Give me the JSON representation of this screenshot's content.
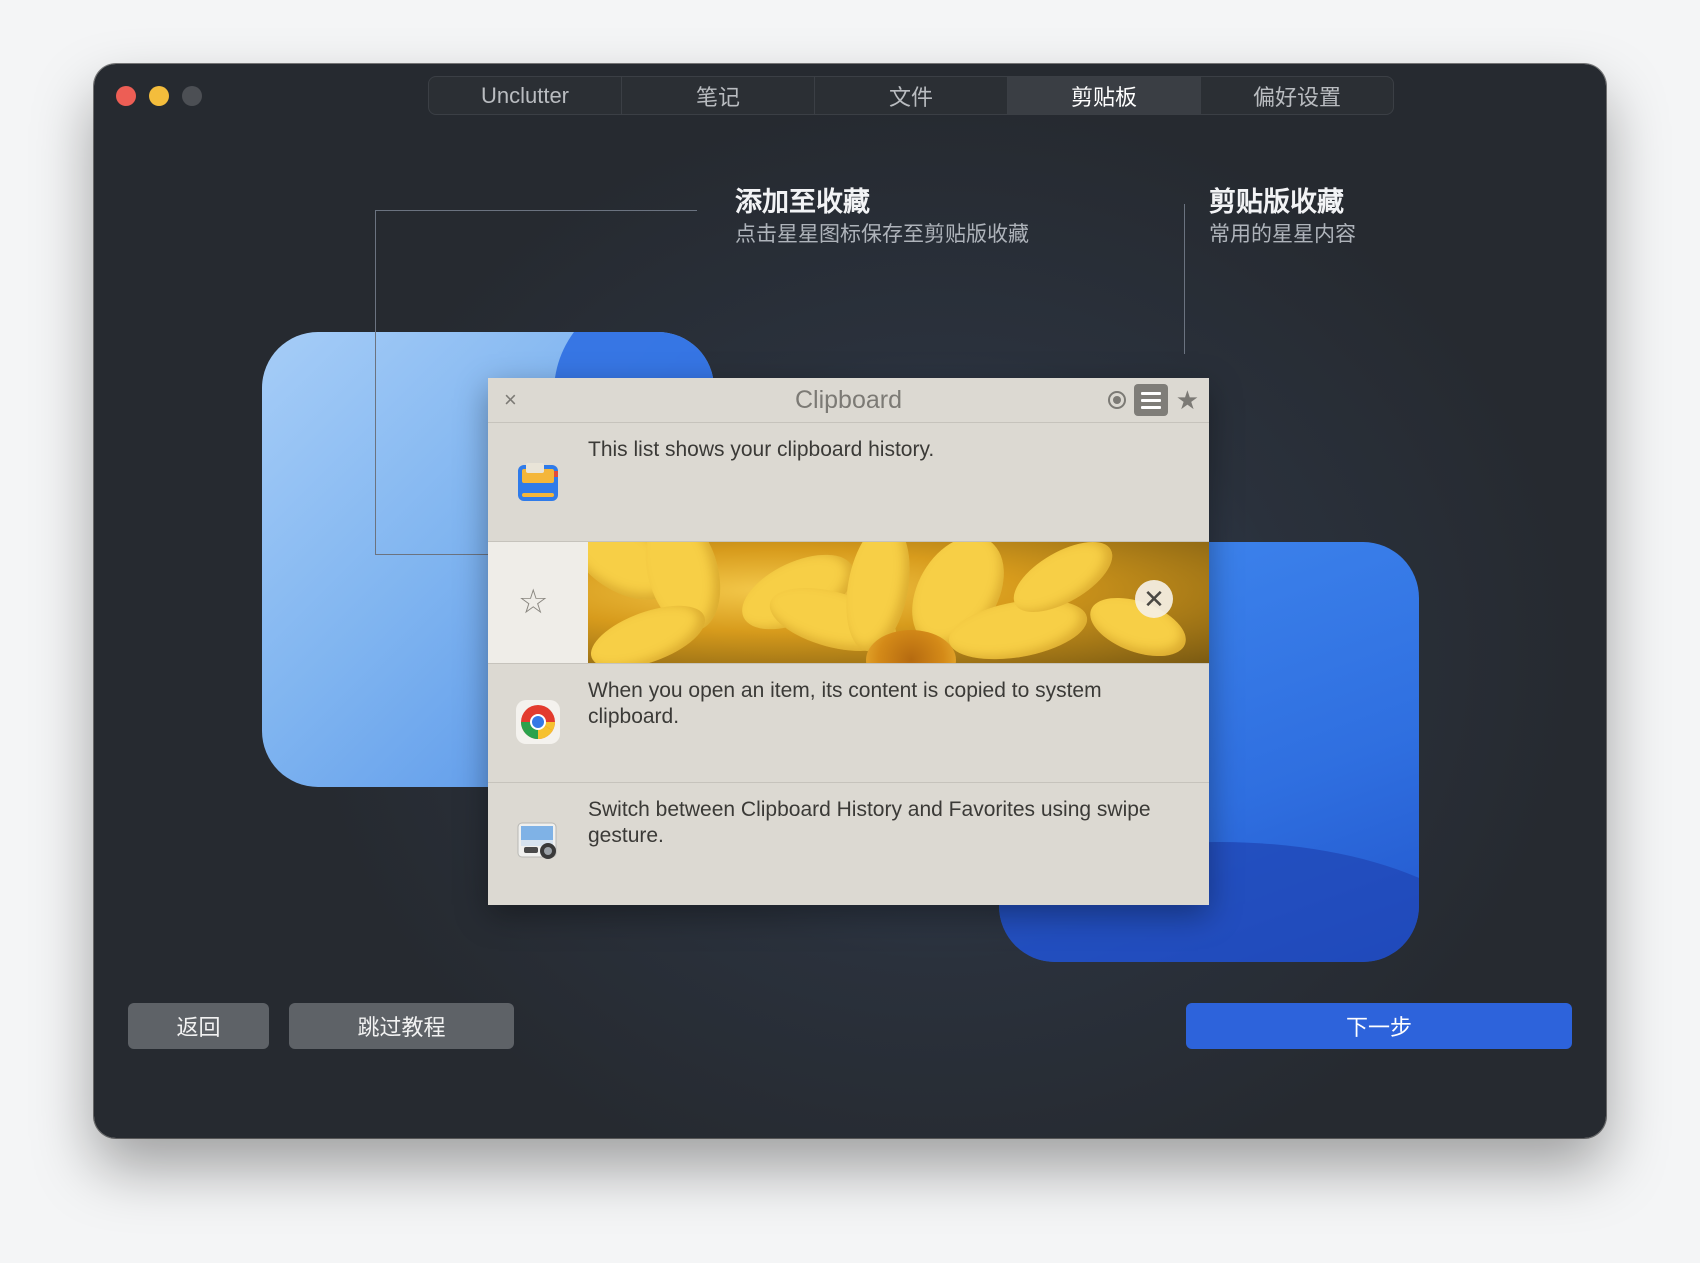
{
  "window": {
    "tabs": [
      {
        "label": "Unclutter",
        "active": false
      },
      {
        "label": "笔记",
        "active": false
      },
      {
        "label": "文件",
        "active": false
      },
      {
        "label": "剪贴板",
        "active": true
      },
      {
        "label": "偏好设置",
        "active": false
      }
    ]
  },
  "callouts": {
    "left_title": "添加至收藏",
    "left_sub": "点击星星图标保存至剪贴版收藏",
    "right_title": "剪贴版收藏",
    "right_sub": "常用的星星内容"
  },
  "clipboard": {
    "close_glyph": "×",
    "title": "Clipboard",
    "header_icons": [
      "target-icon",
      "list-icon",
      "star-icon"
    ],
    "items": [
      {
        "text": "This list shows your clipboard history.",
        "icon": "clipboard-app-icon"
      },
      {
        "text": "When you open an item, its content is copied to system clipboard.",
        "icon": "chrome-icon"
      },
      {
        "text": "Switch between Clipboard History and Favorites using swipe gesture.",
        "icon": "preview-icon"
      }
    ],
    "image_item": {
      "icon": "star-outline-icon",
      "remove_glyph": "✕"
    }
  },
  "buttons": {
    "back": "返回",
    "skip": "跳过教程",
    "next": "下一步"
  },
  "colors": {
    "accent": "#2d63db",
    "window_bg": "#2a2e33",
    "panel_bg": "#dcd9d2"
  }
}
